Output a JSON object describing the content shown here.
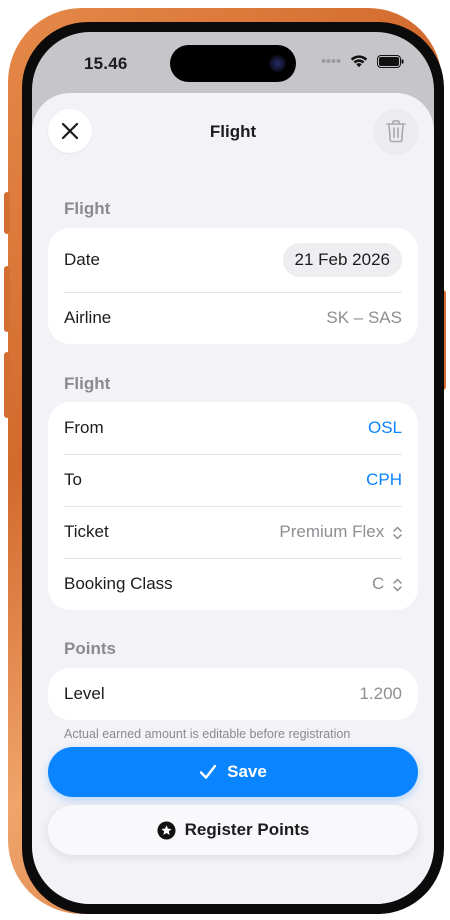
{
  "status_bar": {
    "time": "15.46",
    "icons": [
      "signal-dots-icon",
      "wifi-icon",
      "battery-icon"
    ]
  },
  "sheet": {
    "title": "Flight",
    "close_icon": "close-icon",
    "delete_icon": "trash-icon"
  },
  "sections": {
    "flight_info": {
      "header": "Flight",
      "date_label": "Date",
      "date_value": "21 Feb 2026",
      "airline_label": "Airline",
      "airline_value": "SK – SAS"
    },
    "route": {
      "header": "Flight",
      "from_label": "From",
      "from_value": "OSL",
      "to_label": "To",
      "to_value": "CPH",
      "ticket_label": "Ticket",
      "ticket_value": "Premium Flex",
      "booking_label": "Booking Class",
      "booking_value": "C"
    },
    "points": {
      "header": "Points",
      "level_label": "Level",
      "level_value": "1.200",
      "footnote": "Actual earned amount is editable before registration"
    }
  },
  "actions": {
    "save_label": "Save",
    "register_label": "Register Points"
  },
  "colors": {
    "accent": "#0a84ff",
    "sheet_bg": "#f2f2f7",
    "frame": "#d2692d"
  }
}
